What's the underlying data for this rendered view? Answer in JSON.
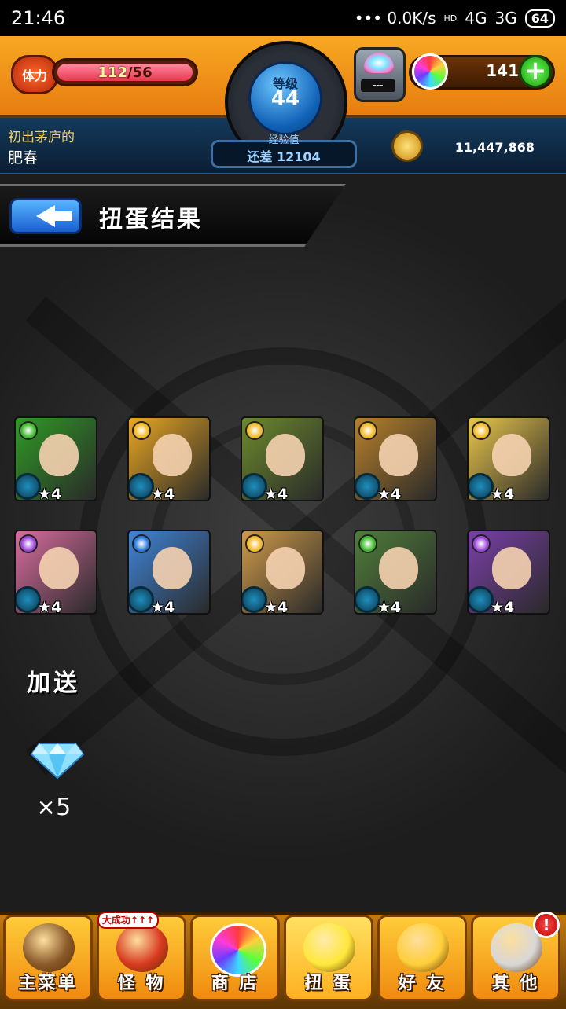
{
  "statusbar": {
    "time": "21:46",
    "network_speed": "••• 0.0K/s",
    "signal1": "4G",
    "signal2": "3G",
    "hd": "HD",
    "battery": "64"
  },
  "header": {
    "stamina_label": "体力",
    "stamina_current": "112",
    "stamina_max": "/56",
    "stamina_fraction": 1.0,
    "level_label": "等级",
    "level_value": "44",
    "exp_label": "经验值",
    "exp_text": "还差 12104",
    "gacha_slot": "---",
    "orb_count": "141",
    "player_title": "初出茅庐的",
    "player_name": "肥春",
    "coins": "11,447,868"
  },
  "page": {
    "title": "扭蛋结果"
  },
  "results": [
    {
      "rarity": "★4",
      "attribute": "wood",
      "attr_color": "#3dbb2c",
      "card_bg": "#2f9a25"
    },
    {
      "rarity": "★4",
      "attribute": "light",
      "attr_color": "#f3b928",
      "card_bg": "#e9a622"
    },
    {
      "rarity": "★4",
      "attribute": "light",
      "attr_color": "#f3b928",
      "card_bg": "#6c8a2c"
    },
    {
      "rarity": "★4",
      "attribute": "light",
      "attr_color": "#f3b928",
      "card_bg": "#b7802a"
    },
    {
      "rarity": "★4",
      "attribute": "light",
      "attr_color": "#f3b928",
      "card_bg": "#e9c64a"
    },
    {
      "rarity": "★4",
      "attribute": "dark",
      "attr_color": "#9b46d8",
      "card_bg": "#d86d9e"
    },
    {
      "rarity": "★4",
      "attribute": "water",
      "attr_color": "#2a7ce0",
      "card_bg": "#3f84d6"
    },
    {
      "rarity": "★4",
      "attribute": "light",
      "attr_color": "#f3b928",
      "card_bg": "#cf9a4a"
    },
    {
      "rarity": "★4",
      "attribute": "wood",
      "attr_color": "#3dbb2c",
      "card_bg": "#4f7d3a"
    },
    {
      "rarity": "★4",
      "attribute": "dark",
      "attr_color": "#9b46d8",
      "card_bg": "#7a3fa8"
    }
  ],
  "bonus": {
    "label": "加送",
    "item_icon": "diamond-icon",
    "count": "×5"
  },
  "nav": {
    "badge": "大成功↑↑↑",
    "alert": "!",
    "items": [
      {
        "label": "主菜单",
        "icon": "castle-gate-icon",
        "color": "#8a5a2a"
      },
      {
        "label": "怪 物",
        "icon": "monster-icon",
        "color": "#d83a20"
      },
      {
        "label": "商 店",
        "icon": "rainbow-orb-icon",
        "color": "#9ad8ff"
      },
      {
        "label": "扭 蛋",
        "icon": "egg-icon",
        "color": "#ffe83a"
      },
      {
        "label": "好 友",
        "icon": "friends-balloon-icon",
        "color": "#ffcf3a"
      },
      {
        "label": "其 他",
        "icon": "other-menu-icon",
        "color": "#d8d8d8"
      }
    ]
  }
}
